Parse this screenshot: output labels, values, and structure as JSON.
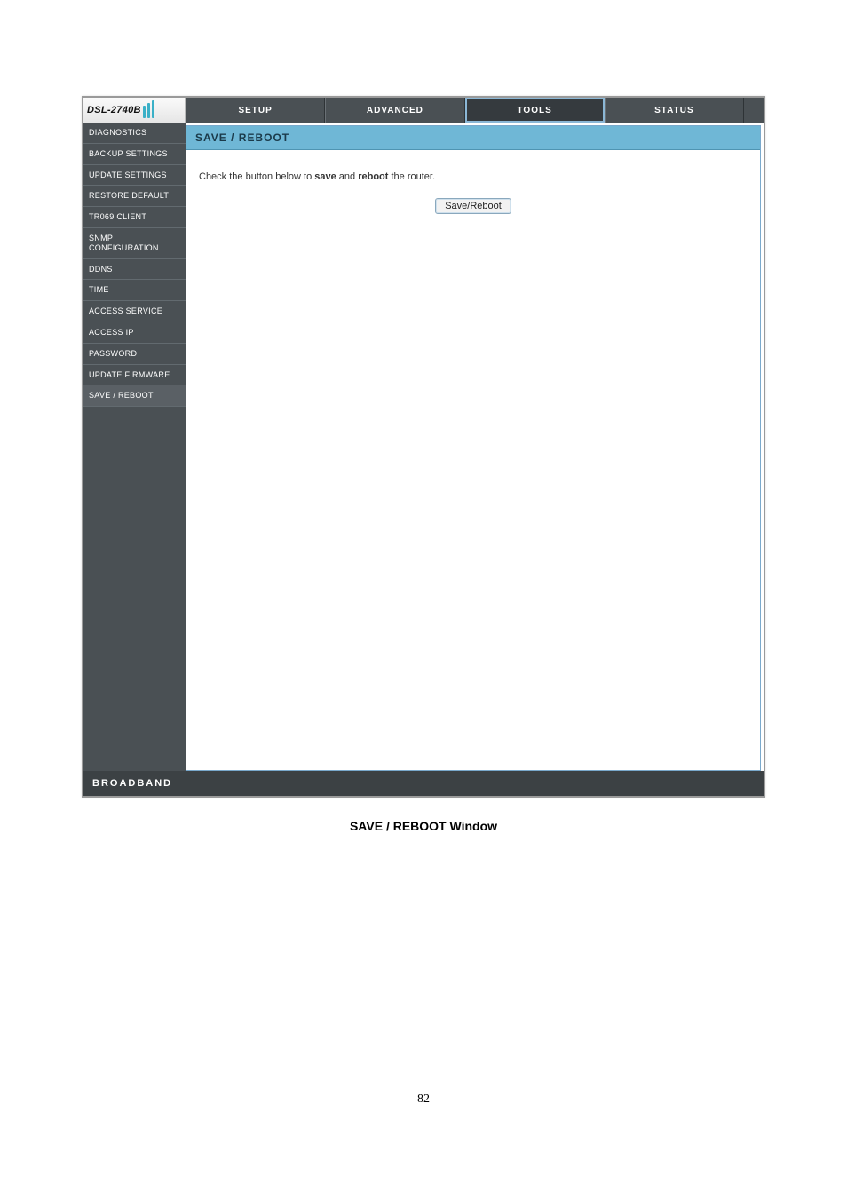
{
  "model_label": "DSL-2740B",
  "tabs": [
    {
      "label": "SETUP"
    },
    {
      "label": "ADVANCED"
    },
    {
      "label": "TOOLS"
    },
    {
      "label": "STATUS"
    }
  ],
  "active_tab_index": 2,
  "sidebar": {
    "items": [
      {
        "label": "DIAGNOSTICS"
      },
      {
        "label": "BACKUP SETTINGS"
      },
      {
        "label": "UPDATE SETTINGS"
      },
      {
        "label": "RESTORE DEFAULT"
      },
      {
        "label": "TR069 CLIENT"
      },
      {
        "label": "SNMP CONFIGURATION"
      },
      {
        "label": "DDNS"
      },
      {
        "label": "TIME"
      },
      {
        "label": "ACCESS SERVICE"
      },
      {
        "label": "ACCESS IP"
      },
      {
        "label": "PASSWORD"
      },
      {
        "label": "UPDATE FIRMWARE"
      },
      {
        "label": "SAVE / REBOOT"
      }
    ],
    "active_index": 12
  },
  "panel": {
    "header": "SAVE / REBOOT",
    "instruction_pre": "Check the button below to ",
    "instruction_b1": "save",
    "instruction_mid": " and ",
    "instruction_b2": "reboot",
    "instruction_post": " the router.",
    "button_label": "Save/Reboot"
  },
  "footer": "BROADBAND",
  "caption": "SAVE / REBOOT Window",
  "page_number": "82"
}
